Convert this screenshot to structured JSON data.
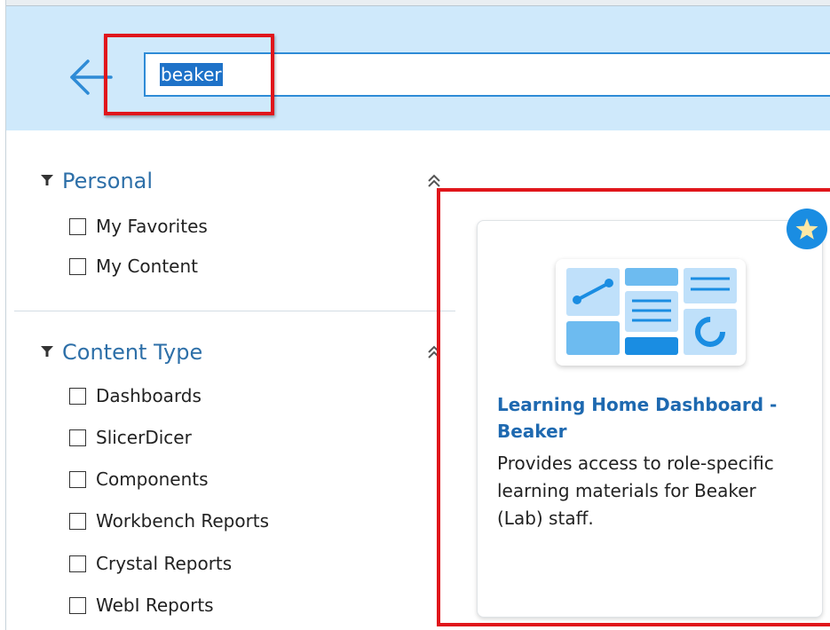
{
  "search": {
    "value": "beaker"
  },
  "filters": {
    "personal": {
      "title": "Personal",
      "items": [
        "My Favorites",
        "My Content"
      ]
    },
    "content_type": {
      "title": "Content Type",
      "items": [
        "Dashboards",
        "SlicerDicer",
        "Components",
        "Workbench Reports",
        "Crystal Reports",
        "WebI Reports"
      ]
    }
  },
  "result_card": {
    "title": "Learning Home Dashboard - Beaker",
    "description": "Provides access to role-specific learning materials for Beaker (Lab) staff.",
    "favorite_icon": "star-icon",
    "thumbnail_icon": "dashboard-thumbnail-icon"
  },
  "colors": {
    "header_bg": "#cfe9fb",
    "accent_blue": "#2e8bd6",
    "highlight_red": "#e0161b",
    "title_blue": "#1e69b0"
  }
}
